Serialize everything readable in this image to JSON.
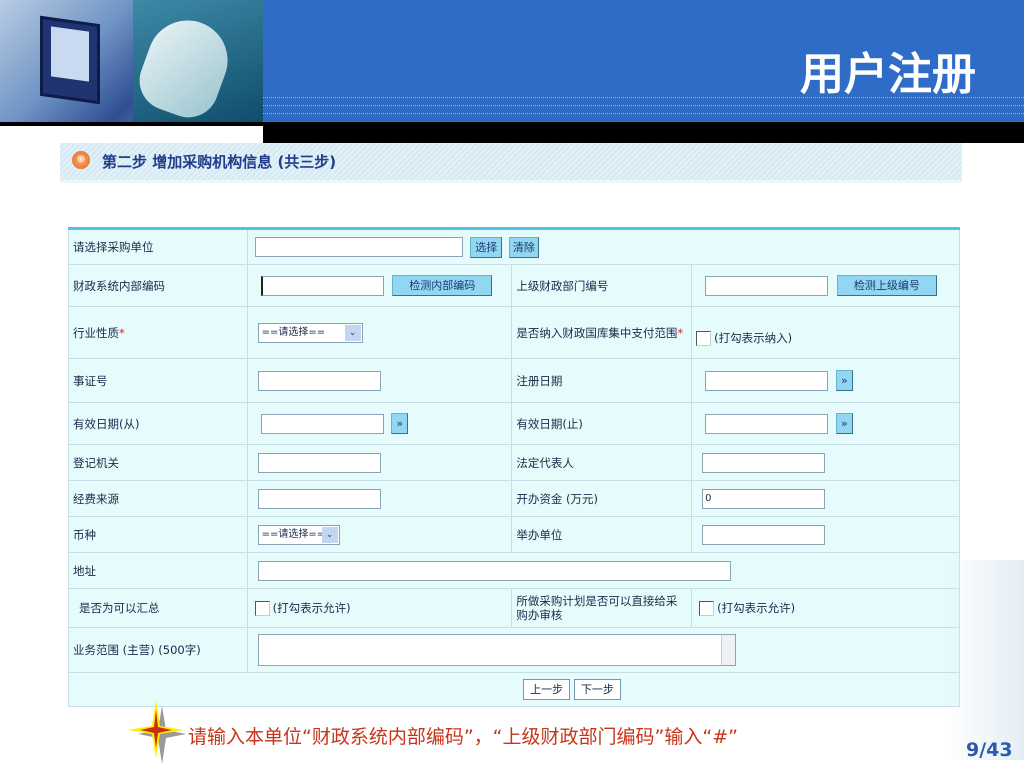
{
  "slide": {
    "title": "用户注册",
    "page": "9/43",
    "note": "请输入本单位“财政系统内部编码”，“上级财政部门编码”输入“#”"
  },
  "form": {
    "step_title": "第二步  增加采购机构信息 (共三步)",
    "purchase_unit": {
      "label": "请选择采购单位",
      "value": "",
      "select_button": "选择",
      "clear_button": "清除"
    },
    "internal_code": {
      "label": "财政系统内部编码",
      "value": "",
      "check_button": "检测内部编码"
    },
    "parent_code": {
      "label": "上级财政部门编号",
      "value": "",
      "check_button": "检测上级编号"
    },
    "industry": {
      "label": "行业性质",
      "required": "*",
      "selected": "==请选择=="
    },
    "treasury": {
      "label": "是否纳入财政国库集中支付范围",
      "required": "*",
      "checkbox_hint": "(打勾表示纳入)",
      "checked": false
    },
    "certificate_no": {
      "label": "事证号",
      "value": ""
    },
    "register_date": {
      "label": "注册日期",
      "value": "",
      "picker": "»"
    },
    "valid_from": {
      "label": "有效日期(从)",
      "value": "",
      "picker": "»"
    },
    "valid_to": {
      "label": "有效日期(止)",
      "value": "",
      "picker": "»"
    },
    "registration_authority": {
      "label": "登记机关",
      "value": ""
    },
    "legal_rep": {
      "label": "法定代表人",
      "value": ""
    },
    "fund_source": {
      "label": "经费来源",
      "value": ""
    },
    "startup_capital": {
      "label": "开办资金 (万元)",
      "value": "0"
    },
    "currency": {
      "label": "币种",
      "selected": "==请选择=="
    },
    "sponsor": {
      "label": "举办单位",
      "value": ""
    },
    "address": {
      "label": "地址",
      "value": ""
    },
    "summarizable": {
      "label": "是否为可以汇总",
      "checkbox_hint": "(打勾表示允许)",
      "checked": false
    },
    "direct_review": {
      "label": "所做采购计划是否可以直接给采购办审核",
      "checkbox_hint": "(打勾表示允许)",
      "checked": false
    },
    "business_scope": {
      "label": "业务范围 (主营) (500字)",
      "value": ""
    },
    "prev_button": "上一步",
    "next_button": "下一步"
  }
}
